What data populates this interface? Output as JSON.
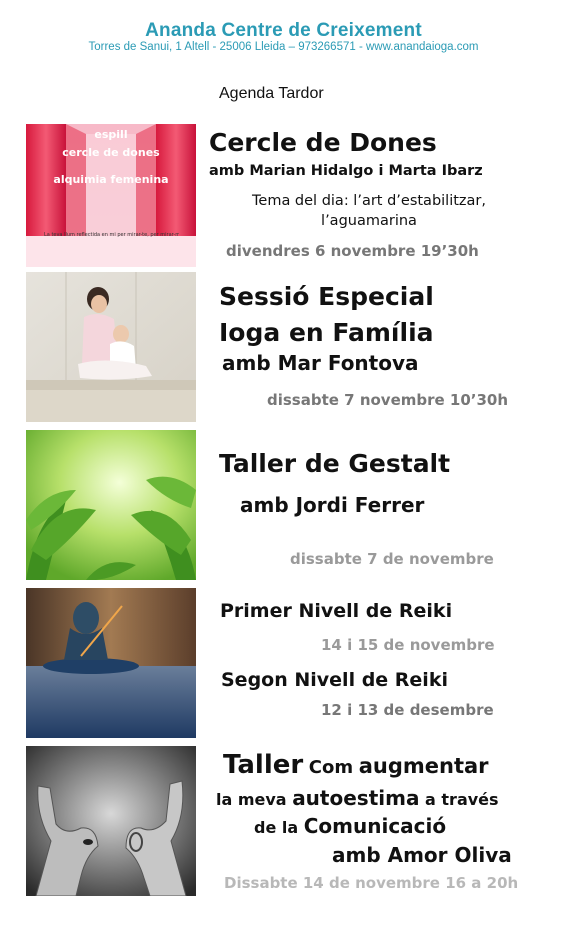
{
  "header": {
    "title": "Ananda Centre de Creixement",
    "address": "Torres de Sanui, 1 Altell - 25006 Lleida – 973266571 - www.anandaioga.com"
  },
  "agenda": {
    "title": "Agenda Tardor"
  },
  "events": [
    {
      "title": "Cercle de Dones",
      "with": "amb Marian Hidalgo i Marta Ibarz",
      "topic_line1": "Tema del dia: l’art d’estabilitzar,",
      "topic_line2": "l’aguamarina",
      "date": "divendres 6 novembre 19’30h",
      "image_text": {
        "line1": "espill",
        "line2": "cercle de dones",
        "line3": "alquimia femenina",
        "caption": "La teva llum reflectida en mi per mirar-te, per mirar-me..."
      }
    },
    {
      "title_line1": "Sessió Especial",
      "title_line2": "Ioga en Família",
      "with": "amb Mar Fontova",
      "date": "dissabte 7 novembre 10’30h"
    },
    {
      "title": "Taller de Gestalt",
      "with": "amb Jordi Ferrer",
      "date": "dissabte 7 de novembre"
    },
    {
      "title_a": "Primer Nivell de Reiki",
      "date_a": "14 i 15 de novembre",
      "title_b": "Segon Nivell de Reiki",
      "date_b": "12 i 13 de desembre"
    },
    {
      "word_taller": "Taller",
      "word_com": "Com",
      "word_augmentar": "augmentar",
      "word_la_meva": "la meva",
      "word_autoestima": "autoestima",
      "word_a_traves": "a través",
      "word_de_la": "de la",
      "word_comunicacio": "Comunicació",
      "with": "amb Amor Oliva",
      "date": "Dissabte 14 de novembre 16 a 20h"
    }
  ],
  "colors": {
    "header": "#2b9bb5",
    "text": "#111111",
    "date_gray": "#777777",
    "date_light": "#9a9a9a"
  }
}
